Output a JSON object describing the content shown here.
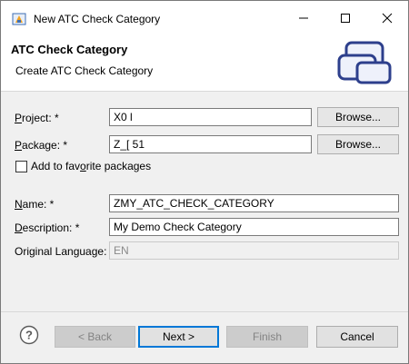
{
  "window": {
    "title": "New ATC Check Category"
  },
  "banner": {
    "title": "ATC Check Category",
    "subtitle": "Create ATC Check Category"
  },
  "form": {
    "project": {
      "label_key": "P",
      "label_rest": "roject: *",
      "value": "X0        l",
      "browse": "Browse..."
    },
    "package": {
      "label_key": "P",
      "label_rest": "ackage: *",
      "value": "Z_[         51",
      "browse": "Browse..."
    },
    "favorite": {
      "label_pre": "Add to fav",
      "label_key": "o",
      "label_post": "rite packages",
      "checked": false
    },
    "name": {
      "label_key": "N",
      "label_rest": "ame: *",
      "value": "ZMY_ATC_CHECK_CATEGORY"
    },
    "description": {
      "label_key": "D",
      "label_rest": "escription: *",
      "value": "My Demo Check Category"
    },
    "language": {
      "label": "Original Language:",
      "value": "EN"
    }
  },
  "footer": {
    "back": "< Back",
    "next": "Next >",
    "finish": "Finish",
    "cancel": "Cancel"
  },
  "colors": {
    "accent": "#0078d7",
    "dialog_bg": "#f0f0f0"
  }
}
